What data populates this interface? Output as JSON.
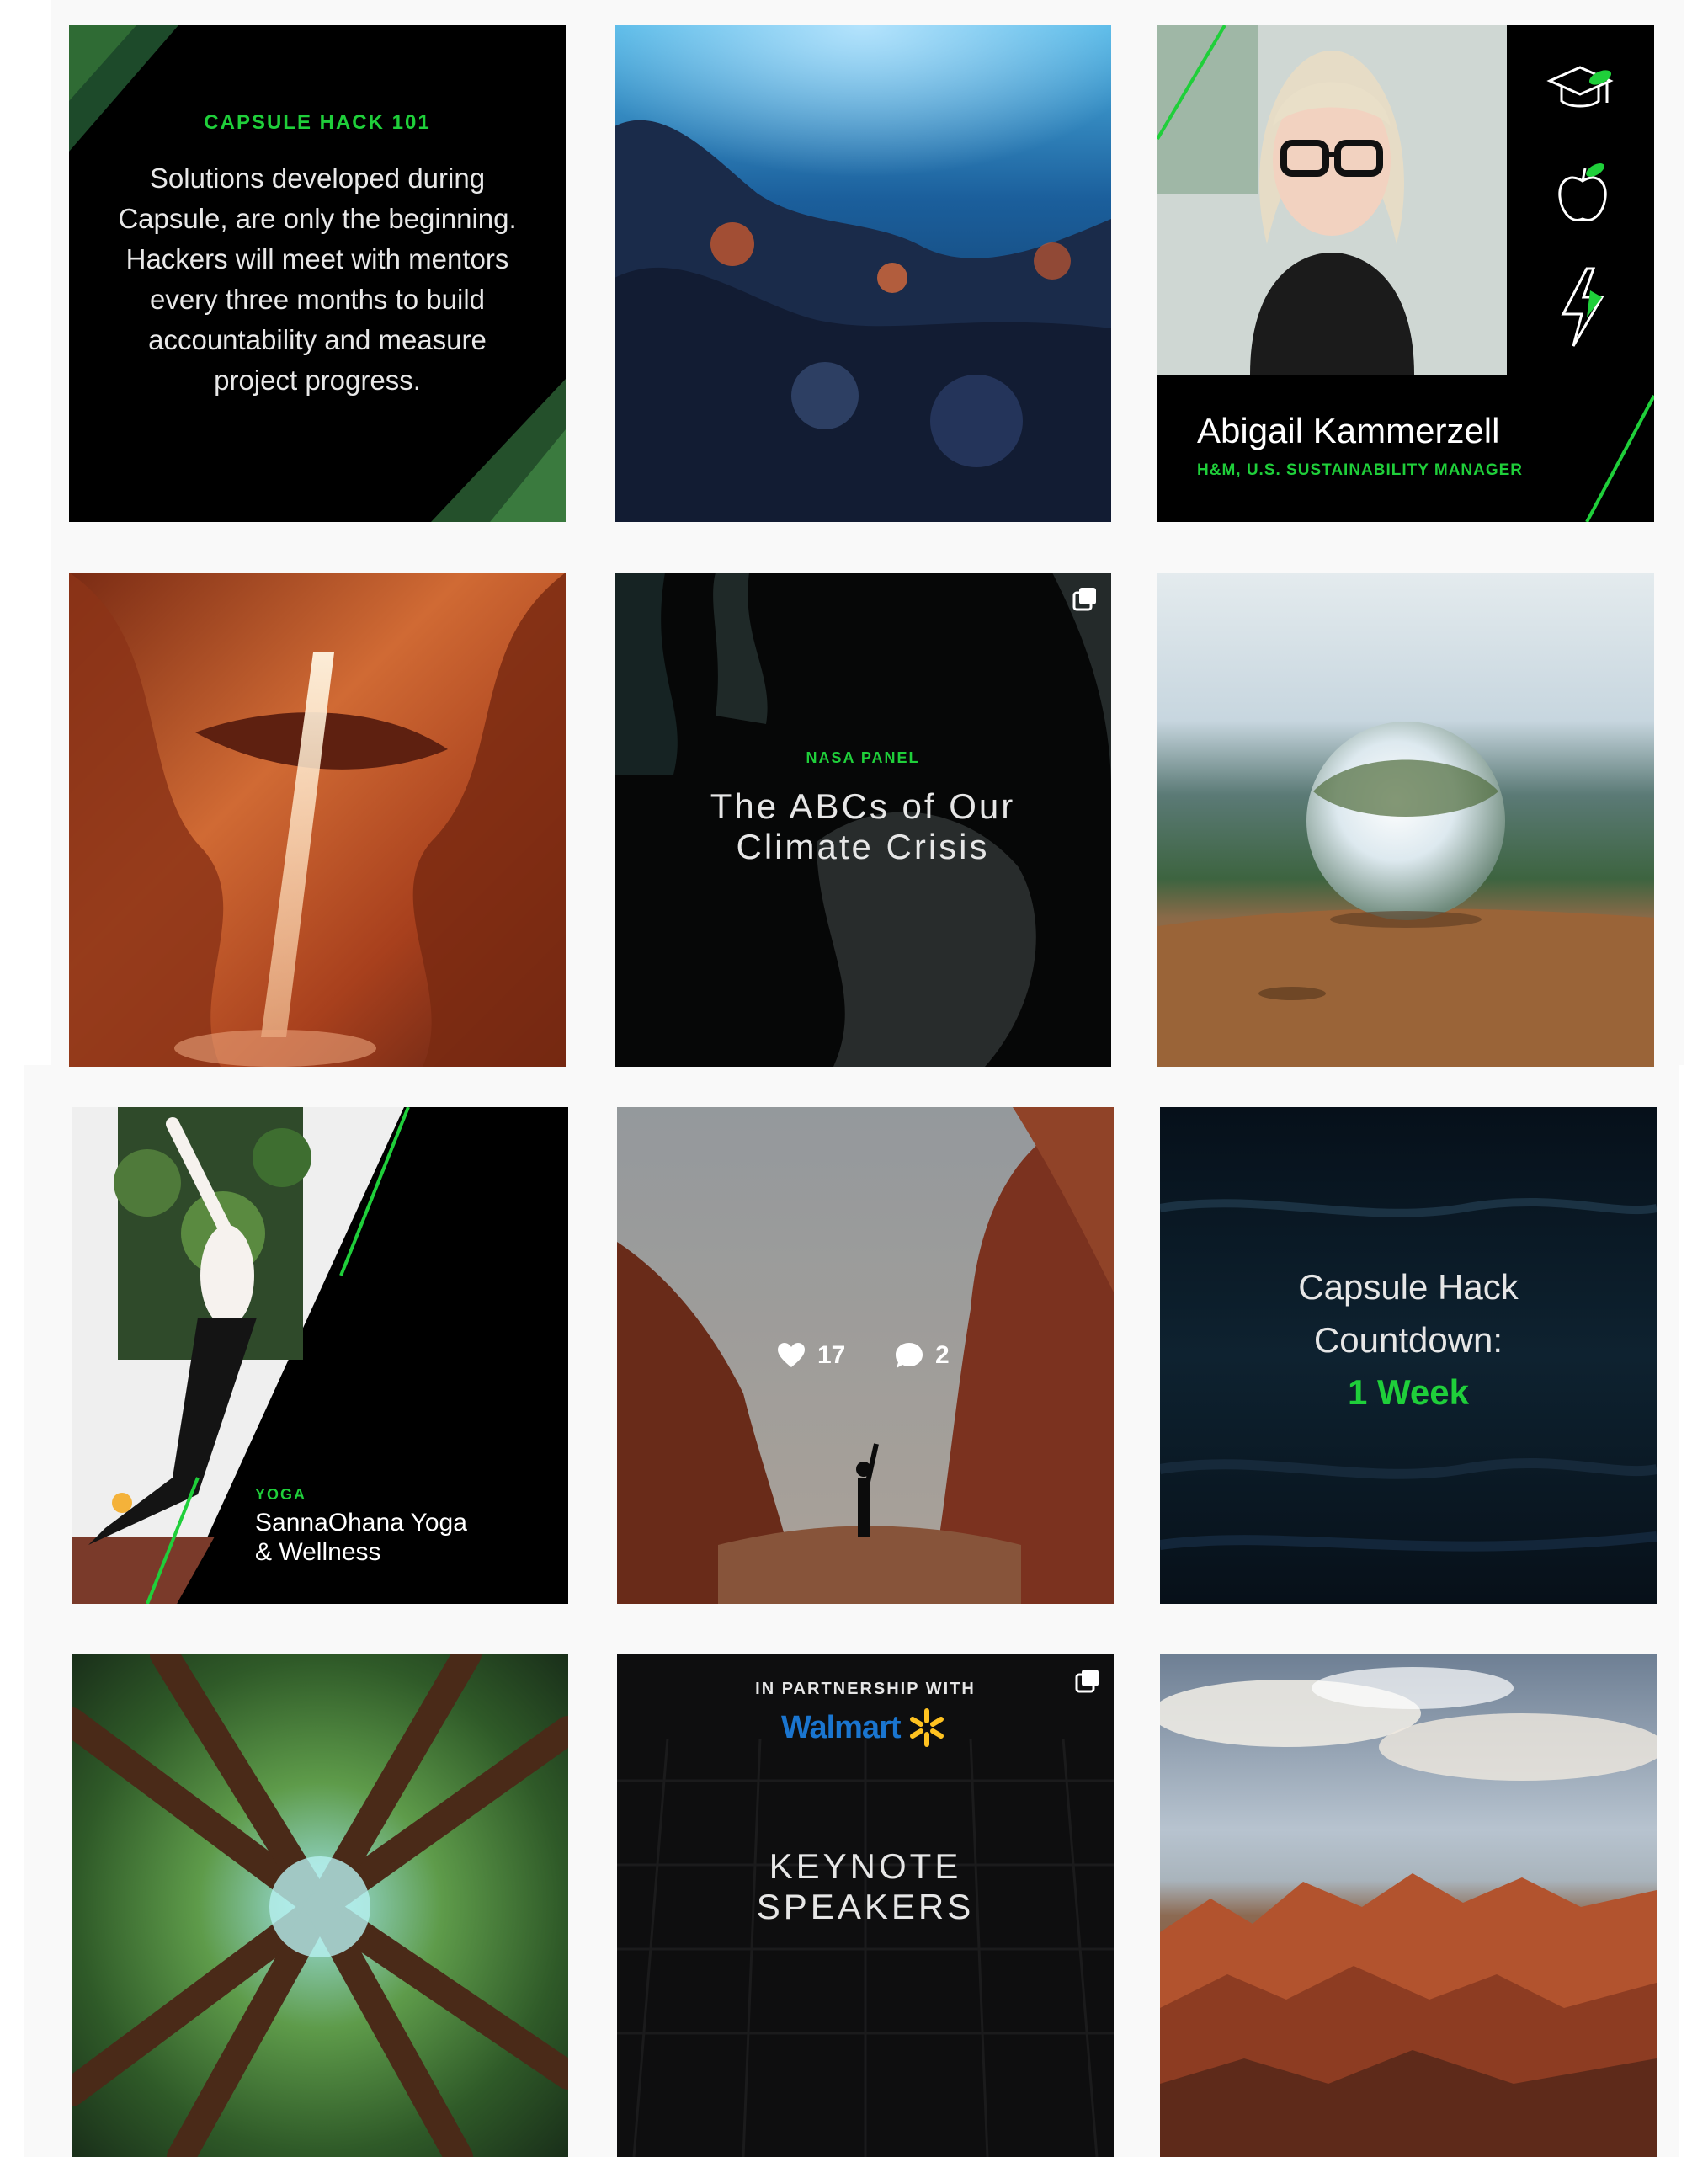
{
  "tiles": {
    "capsule_hack_101": {
      "title": "CAPSULE HACK 101",
      "body": "Solutions developed during Capsule, are only the beginning. Hackers will meet with mentors every three months to build accountability and measure project progress."
    },
    "speaker": {
      "name": "Abigail Kammerzell",
      "role": "H&M, U.S. SUSTAINABILITY MANAGER",
      "icons": [
        "graduation-cap-icon",
        "apple-icon",
        "lightning-icon"
      ]
    },
    "nasa_panel": {
      "kicker": "NASA PANEL",
      "title_line1": "The ABCs of Our",
      "title_line2": "Climate Crisis"
    },
    "yoga": {
      "kicker": "YOGA",
      "title_line1": "SannaOhana Yoga",
      "title_line2": "& Wellness"
    },
    "canyon_hover": {
      "likes": "17",
      "comments": "2"
    },
    "countdown": {
      "line1": "Capsule Hack",
      "line2": "Countdown:",
      "line3": "1 Week"
    },
    "keynote": {
      "partnership": "IN PARTNERSHIP WITH",
      "brand": "Walmart",
      "line1": "KEYNOTE",
      "line2": "SPEAKERS"
    }
  },
  "colors": {
    "accent_green": "#1fcf3a",
    "walmart_blue": "#1a75cf",
    "walmart_yellow": "#ffc220"
  }
}
